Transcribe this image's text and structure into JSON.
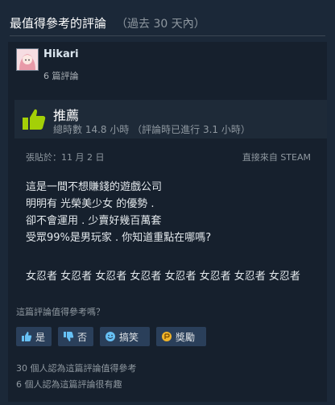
{
  "header": {
    "title": "最值得參考的評論",
    "subtitle": "（過去 30 天內）"
  },
  "user": {
    "name": "Hikari",
    "review_count": "6 篇評論"
  },
  "verdict": {
    "label": "推薦",
    "hours": "總時數 14.8 小時 （評論時已進行 3.1 小時）",
    "icon": "thumbs-up-icon"
  },
  "meta": {
    "posted": "張貼於：11 月 2 日",
    "source": "直接來自 STEAM"
  },
  "review": {
    "paragraphs": [
      "這是一間不想賺錢的遊戲公司",
      "明明有 光榮美少女 的優勢 .",
      "卻不會運用 . 少賣好幾百萬套",
      "受眾99%是男玩家 . 你知道重點在哪嗎?"
    ],
    "repeat_line": "女忍者 女忍者 女忍者 女忍者 女忍者 女忍者 女忍者 女忍者"
  },
  "helpful": {
    "question": "這篇評論值得參考嗎？",
    "buttons": {
      "yes": "是",
      "no": "否",
      "funny": "搞笑",
      "award": "獎勵"
    }
  },
  "stats": {
    "helpful_count": "30 個人認為這篇評論值得參考",
    "funny_count": "6 個人認為這篇評論很有趣"
  },
  "colors": {
    "background": "#1b2838",
    "card": "#16202d",
    "verdict_bar": "#1e2a38",
    "button": "#2a3f5a",
    "thumb_green": "#a4d007"
  }
}
